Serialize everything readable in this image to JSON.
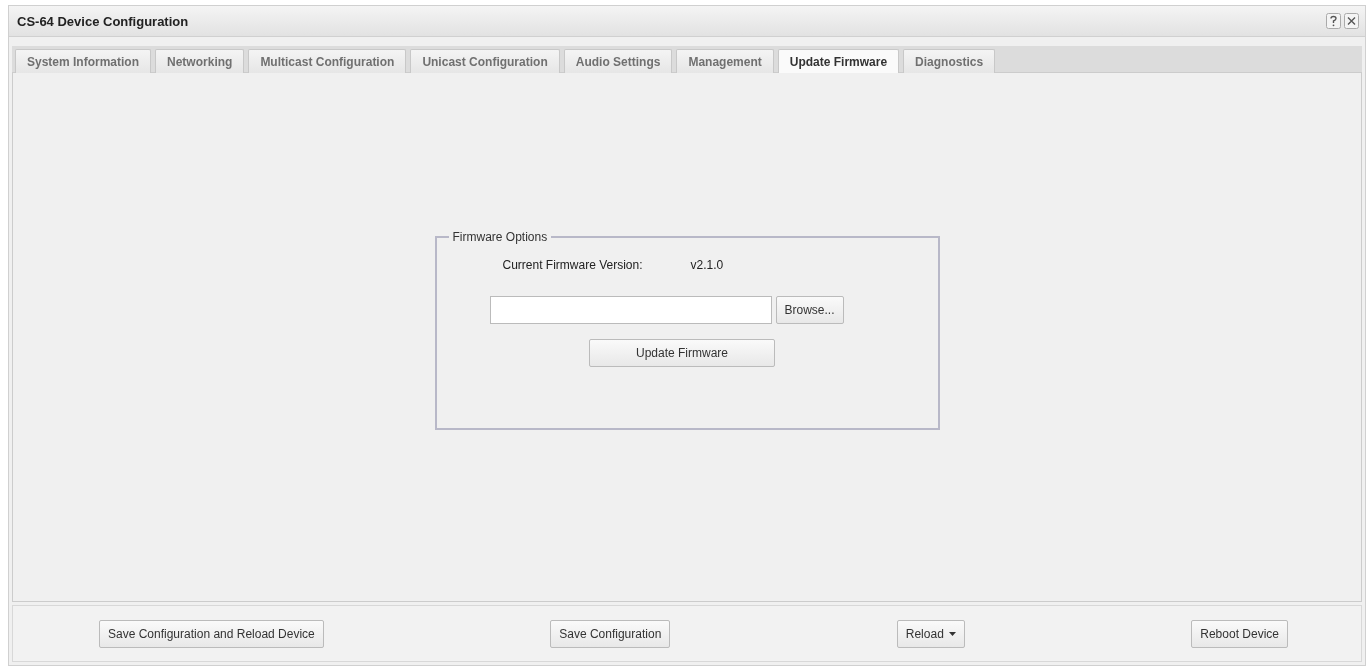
{
  "window": {
    "title": "CS-64 Device Configuration"
  },
  "tabs": [
    {
      "label": "System Information",
      "selected": false
    },
    {
      "label": "Networking",
      "selected": false
    },
    {
      "label": "Multicast Configuration",
      "selected": false
    },
    {
      "label": "Unicast Configuration",
      "selected": false
    },
    {
      "label": "Audio Settings",
      "selected": false
    },
    {
      "label": "Management",
      "selected": false
    },
    {
      "label": "Update Firmware",
      "selected": true
    },
    {
      "label": "Diagnostics",
      "selected": false
    }
  ],
  "firmware_options": {
    "legend": "Firmware Options",
    "version_label": "Current Firmware Version:",
    "version": "v2.1.0",
    "browse_button": "Browse...",
    "update_button": "Update Firmware"
  },
  "footer_buttons": [
    {
      "label": "Save Configuration and Reload Device",
      "kind": "plain"
    },
    {
      "label": "Save Configuration",
      "kind": "plain"
    },
    {
      "label": "Reload",
      "kind": "dropdown"
    },
    {
      "label": "Reboot Device",
      "kind": "plain"
    }
  ]
}
